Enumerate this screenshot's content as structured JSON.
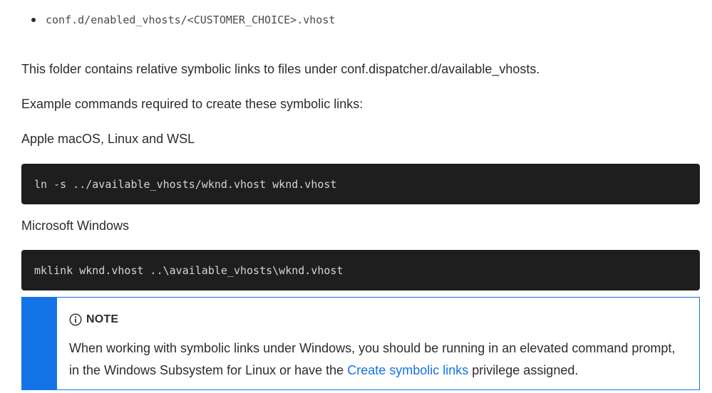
{
  "bullet_list": {
    "items": [
      "conf.d/enabled_vhosts/<CUSTOMER_CHOICE>.vhost"
    ]
  },
  "paragraphs": {
    "folder_description": "This folder contains relative symbolic links to files under conf.dispatcher.d/available_vhosts.",
    "example_intro": "Example commands required to create these symbolic links:",
    "platform_unix": "Apple macOS, Linux and WSL",
    "platform_windows": "Microsoft Windows"
  },
  "code_blocks": {
    "unix_command": "ln -s ../available_vhosts/wknd.vhost wknd.vhost",
    "windows_command": "mklink wknd.vhost ..\\available_vhosts\\wknd.vhost"
  },
  "note": {
    "icon": "info-circle-icon",
    "title": "NOTE",
    "text_before_link": "When working with symbolic links under Windows, you should be running in an elevated command prompt, in the Windows Subsystem for Linux or have the ",
    "link_text": "Create symbolic links",
    "text_after_link": " privilege assigned."
  },
  "colors": {
    "accent": "#1473e6",
    "code_background": "#1e1e1e",
    "body_text": "#2c2c2c"
  }
}
